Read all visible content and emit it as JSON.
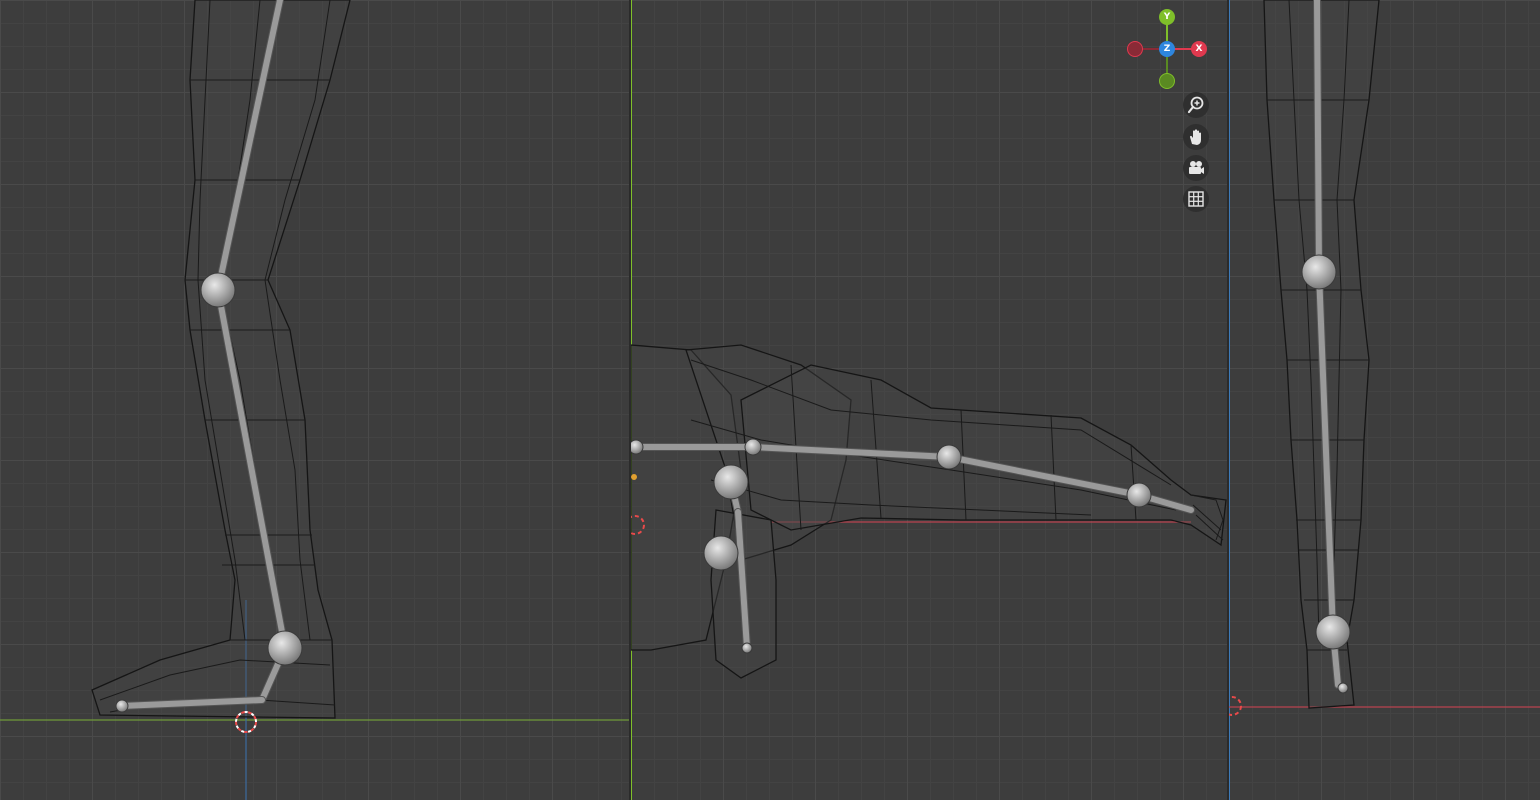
{
  "gizmo": {
    "axes": {
      "y": "Y",
      "z": "Z",
      "x": "X"
    },
    "colors": {
      "x": "#e0394f",
      "y": "#7fbf2a",
      "z": "#2e86de",
      "neg_x": "#8a2a36",
      "neg_y": "#5a8a22"
    }
  },
  "nav_controls": [
    {
      "name": "zoom",
      "icon": "zoom-in-icon"
    },
    {
      "name": "pan",
      "icon": "hand-icon"
    },
    {
      "name": "camera",
      "icon": "camera-icon"
    },
    {
      "name": "ortho",
      "icon": "grid-icon"
    }
  ],
  "viewports": [
    {
      "name": "left",
      "view": "side-leg"
    },
    {
      "name": "middle",
      "view": "top-body-arm"
    },
    {
      "name": "right",
      "view": "front-leg"
    }
  ],
  "colors": {
    "background": "#3d3d3d",
    "grid_minor": "#434343",
    "grid_major": "#4a4a4a",
    "x_axis_line": "#b8434f",
    "y_axis_line": "#7fbf2a",
    "z_axis_line": "#3d7ab8"
  }
}
